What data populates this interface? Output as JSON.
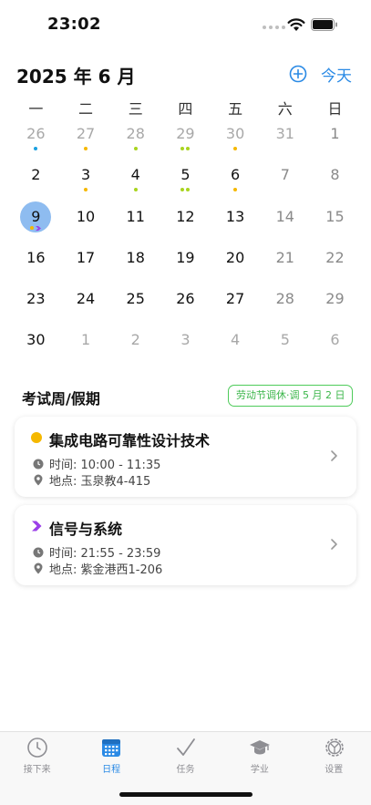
{
  "status": {
    "time": "23:02"
  },
  "header": {
    "month_title": "2025 年 6 月",
    "today_label": "今天"
  },
  "colors": {
    "accent": "#2a8ae5",
    "selected": "#8ebcf0",
    "yellow": "#f5b800",
    "green": "#a9d41f",
    "cyan": "#1aa0e0",
    "purple": "#9b3fe8",
    "badge_green": "#3bb64a"
  },
  "calendar": {
    "weekdays": [
      "一",
      "二",
      "三",
      "四",
      "五",
      "六",
      "日"
    ],
    "weeks": [
      [
        {
          "n": "26",
          "muted": true,
          "dots": [
            "cyan"
          ]
        },
        {
          "n": "27",
          "muted": true,
          "dots": [
            "yellow"
          ]
        },
        {
          "n": "28",
          "muted": true,
          "dots": [
            "green"
          ]
        },
        {
          "n": "29",
          "muted": true,
          "dots": [
            "green",
            "green"
          ]
        },
        {
          "n": "30",
          "muted": true,
          "dots": [
            "yellow"
          ]
        },
        {
          "n": "31",
          "muted": true,
          "dots": []
        },
        {
          "n": "1",
          "muted": false,
          "dots": []
        }
      ],
      [
        {
          "n": "2",
          "dots": []
        },
        {
          "n": "3",
          "dots": [
            "yellow"
          ]
        },
        {
          "n": "4",
          "dots": [
            "green"
          ]
        },
        {
          "n": "5",
          "dots": [
            "green",
            "green"
          ]
        },
        {
          "n": "6",
          "dots": [
            "yellow"
          ]
        },
        {
          "n": "7",
          "dots": []
        },
        {
          "n": "8",
          "dots": []
        }
      ],
      [
        {
          "n": "9",
          "selected": true,
          "dots": [
            "yellow",
            "purple-chevron"
          ]
        },
        {
          "n": "10",
          "dots": []
        },
        {
          "n": "11",
          "dots": []
        },
        {
          "n": "12",
          "dots": []
        },
        {
          "n": "13",
          "dots": []
        },
        {
          "n": "14",
          "dots": []
        },
        {
          "n": "15",
          "dots": []
        }
      ],
      [
        {
          "n": "16",
          "dots": []
        },
        {
          "n": "17",
          "dots": []
        },
        {
          "n": "18",
          "dots": []
        },
        {
          "n": "19",
          "dots": []
        },
        {
          "n": "20",
          "dots": []
        },
        {
          "n": "21",
          "dots": []
        },
        {
          "n": "22",
          "dots": []
        }
      ],
      [
        {
          "n": "23",
          "dots": []
        },
        {
          "n": "24",
          "dots": []
        },
        {
          "n": "25",
          "dots": []
        },
        {
          "n": "26",
          "dots": []
        },
        {
          "n": "27",
          "dots": []
        },
        {
          "n": "28",
          "dots": []
        },
        {
          "n": "29",
          "dots": []
        }
      ],
      [
        {
          "n": "30",
          "dots": []
        },
        {
          "n": "1",
          "muted": true,
          "dots": []
        },
        {
          "n": "2",
          "muted": true,
          "dots": []
        },
        {
          "n": "3",
          "muted": true,
          "dots": []
        },
        {
          "n": "4",
          "muted": true,
          "dots": []
        },
        {
          "n": "5",
          "muted": true,
          "dots": []
        },
        {
          "n": "6",
          "muted": true,
          "dots": []
        }
      ]
    ]
  },
  "section": {
    "title": "考试周/假期",
    "badge": "劳动节调休·调 5 月 2 日"
  },
  "events": [
    {
      "title": "集成电路可靠性设计技术",
      "time": "时间:  10:00 - 11:35",
      "location": "地点:  玉泉教4-415",
      "marker": "yellow-dot-icon"
    },
    {
      "title": "信号与系统",
      "time": "时间:  21:55 - 23:59",
      "location": "地点:  紫金港西1-206",
      "marker": "purple-chevron-icon"
    }
  ],
  "tabs": [
    {
      "label": "接下来",
      "icon": "clock-icon",
      "active": false
    },
    {
      "label": "日程",
      "icon": "calendar-icon",
      "active": true
    },
    {
      "label": "任务",
      "icon": "checkmark-icon",
      "active": false
    },
    {
      "label": "学业",
      "icon": "graduation-cap-icon",
      "active": false
    },
    {
      "label": "设置",
      "icon": "gear-icon",
      "active": false
    }
  ]
}
